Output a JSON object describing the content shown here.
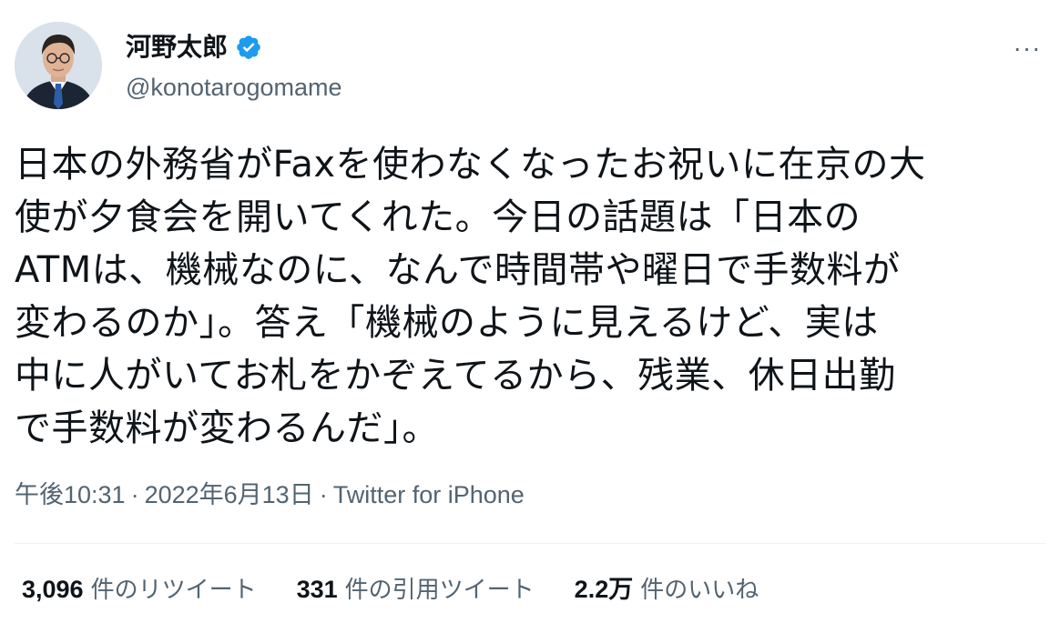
{
  "author": {
    "display_name": "河野太郎",
    "handle": "@konotarogomame",
    "verified": true,
    "avatar_icon": "profile-photo"
  },
  "tweet": {
    "text": "日本の外務省がFaxを使わなくなったお祝いに在京の大\n使が夕食会を開いてくれた。今日の話題は「日本の\nATMは、機械なのに、なんで時間帯や曜日で手数料が\n変わるのか」。答え「機械のように見えるけど、実は\n中に人がいてお札をかぞえてるから、残業、休日出勤\nで手数料が変わるんだ」。",
    "time": "午後10:31",
    "date": "2022年6月13日",
    "separator": "·",
    "source": "Twitter for iPhone"
  },
  "stats": {
    "retweets_count": "3,096",
    "retweets_label": "件のリツイート",
    "quotes_count": "331",
    "quotes_label": "件の引用ツイート",
    "likes_count": "2.2万",
    "likes_label": "件のいいね"
  },
  "menu": {
    "more_icon": "more-icon",
    "more_glyph": "···"
  },
  "colors": {
    "text_primary": "#0f1419",
    "text_secondary": "#536471",
    "verified_blue": "#1d9bf0",
    "divider": "#eff3f4"
  }
}
